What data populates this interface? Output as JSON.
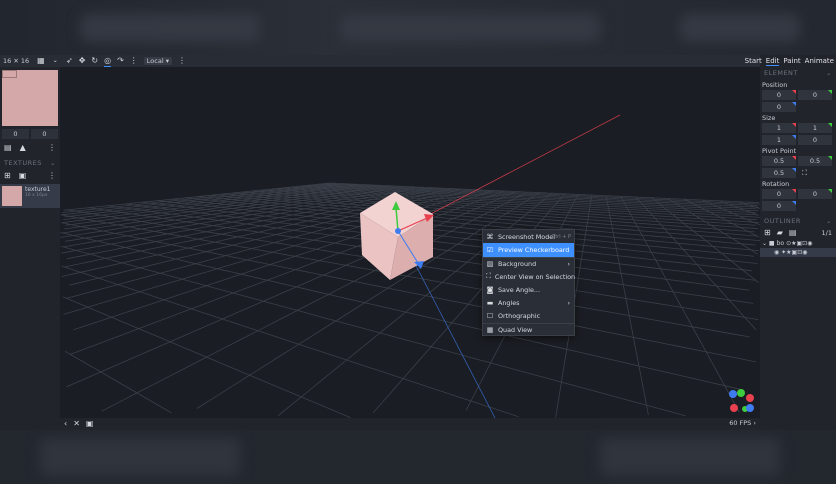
{
  "left_panel": {
    "uv_size": "16 ✕ 16",
    "uv_offset": [
      "0",
      "0"
    ],
    "textures_header": "TEXTURES",
    "texture": {
      "name": "texture1",
      "size": "16 x 16px"
    }
  },
  "toolbar": {
    "space_select": "Local ▾"
  },
  "modes": [
    "Start",
    "Edit",
    "Paint",
    "Animate"
  ],
  "element": {
    "header": "ELEMENT",
    "position_label": "Position",
    "position": [
      "0",
      "0",
      "0"
    ],
    "size_label": "Size",
    "size": [
      "1",
      "1",
      "1",
      "0"
    ],
    "pivot_label": "Pivot Point",
    "pivot": [
      "0.5",
      "0.5",
      "0.5"
    ],
    "rotation_label": "Rotation",
    "rotation": [
      "0",
      "0",
      "0"
    ]
  },
  "outliner": {
    "header": "OUTLINER",
    "count": "1/1",
    "group": "bo"
  },
  "context_menu": {
    "items": [
      {
        "icon": "camera-icon",
        "label": "Screenshot Model",
        "shortcut": "Ctrl + P"
      },
      {
        "icon": "checkbox-checked-icon",
        "label": "Preview Checkerboard",
        "highlighted": true
      },
      {
        "icon": "background-icon",
        "label": "Background",
        "submenu": true
      },
      {
        "icon": "center-icon",
        "label": "Center View on Selection"
      },
      {
        "icon": "photo-camera-icon",
        "label": "Save Angle..."
      },
      {
        "icon": "video-camera-icon",
        "label": "Angles",
        "submenu": true
      },
      {
        "icon": "checkbox-empty-icon",
        "label": "Orthographic"
      },
      {
        "icon": "quad-view-icon",
        "label": "Quad View"
      }
    ]
  },
  "status": {
    "fps": "60 FPS"
  },
  "colors": {
    "accent": "#3e90ff",
    "cube": "#e8b8b8",
    "x_axis": "#e8404f",
    "y_axis": "#3ecb3e",
    "z_axis": "#3e7cf0"
  }
}
